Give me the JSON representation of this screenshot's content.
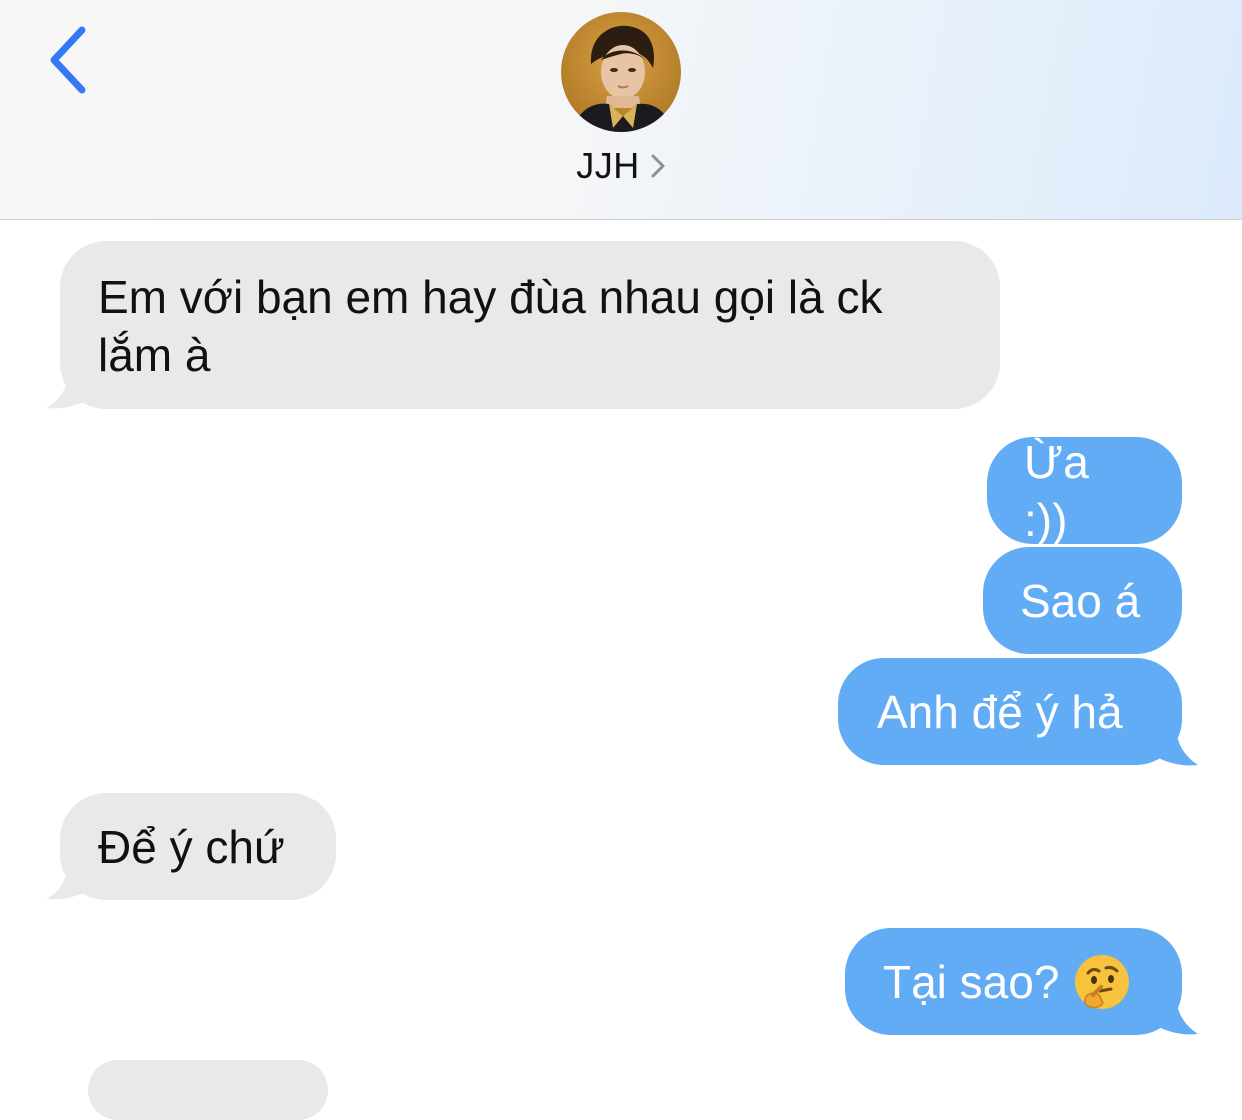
{
  "header": {
    "contact_name": "JJH"
  },
  "messages": [
    {
      "direction": "received",
      "text": "Em với bạn em hay đùa nhau gọi là ck lắm à"
    },
    {
      "direction": "sent",
      "text": "Ừa :))"
    },
    {
      "direction": "sent",
      "text": "Sao á"
    },
    {
      "direction": "sent",
      "text": "Anh để ý hả"
    },
    {
      "direction": "received",
      "text": "Để ý chứ"
    },
    {
      "direction": "sent",
      "text": "Tại sao?",
      "emoji": "thinking-face"
    }
  ],
  "colors": {
    "accent": "#3478f6",
    "sent_bubble": "#62abf5",
    "received_bubble": "#e9e9eb"
  }
}
